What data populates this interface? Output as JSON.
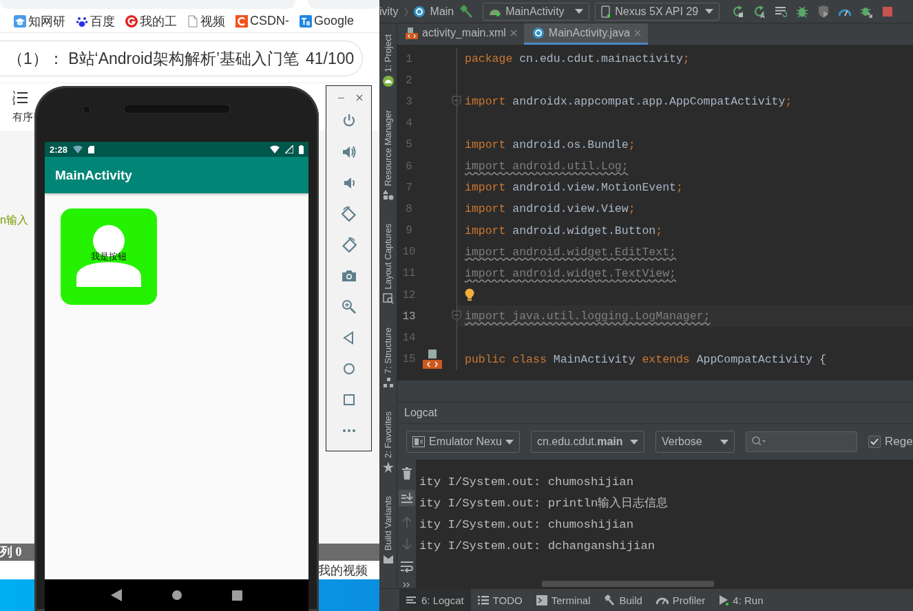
{
  "browser": {
    "bookmarks": [
      {
        "label": "知网研",
        "kind": "cap"
      },
      {
        "label": "百度",
        "kind": "paw"
      },
      {
        "label": "我的工",
        "kind": "ring"
      },
      {
        "label": "视频",
        "kind": "page"
      },
      {
        "label": "CSDN-",
        "kind": "square"
      },
      {
        "label": "Google",
        "kind": "translate"
      }
    ],
    "title_field": {
      "value": "（1）： B站‘Android架构解析’基础入门笔",
      "counter": "41/100"
    },
    "toolbar": [
      {
        "label": "有序"
      }
    ],
    "log_fragment": "n输入",
    "status_bar": "列 0",
    "footer_link": "我的视频"
  },
  "emulator": {
    "time": "2:28",
    "app_title": "MainActivity",
    "button_label": "我是按钮"
  },
  "ide": {
    "breadcrumbs": [
      "ivity",
      "Main"
    ],
    "run_config": "MainActivity",
    "device": "Nexus 5X API 29",
    "tool_windows": [
      {
        "label": "1: Project",
        "kind": "project"
      },
      {
        "label": "Resource Manager",
        "kind": "resource"
      },
      {
        "label": "Layout Captures",
        "kind": "layout"
      },
      {
        "label": "7: Structure",
        "kind": "structure"
      },
      {
        "label": "2: Favorites",
        "kind": "favorites"
      },
      {
        "label": "Build Variants",
        "kind": "variants"
      }
    ],
    "editor_tabs": [
      {
        "label": "activity_main.xml",
        "kind": "xml",
        "selected": false
      },
      {
        "label": "MainActivity.java",
        "kind": "java",
        "selected": true
      }
    ],
    "code_lines": [
      {
        "number": "1",
        "tokens": [
          {
            "text": "package",
            "kind": "keyword"
          },
          {
            "text": " cn.edu.cdut.mainactivity",
            "kind": "plain"
          },
          {
            "text": ";",
            "kind": "keyword"
          }
        ],
        "unused": false,
        "current": false
      },
      {
        "number": "2",
        "current": false
      },
      {
        "number": "3",
        "tokens": [
          {
            "text": "import",
            "kind": "keyword"
          },
          {
            "text": " androidx.appcompat.app.AppCompatActivity",
            "kind": "plain"
          },
          {
            "text": ";",
            "kind": "keyword"
          }
        ],
        "unused": false,
        "current": false,
        "kind": "fold"
      },
      {
        "number": "4",
        "current": false
      },
      {
        "number": "5",
        "tokens": [
          {
            "text": "import",
            "kind": "keyword"
          },
          {
            "text": " android.os.Bundle",
            "kind": "plain"
          },
          {
            "text": ";",
            "kind": "keyword"
          }
        ],
        "unused": false,
        "current": false
      },
      {
        "number": "6",
        "tokens": [
          {
            "text": "import android.util.Log;",
            "kind": "plain"
          }
        ],
        "unused": true,
        "current": false
      },
      {
        "number": "7",
        "tokens": [
          {
            "text": "import",
            "kind": "keyword"
          },
          {
            "text": " android.view.MotionEvent",
            "kind": "plain"
          },
          {
            "text": ";",
            "kind": "keyword"
          }
        ],
        "unused": false,
        "current": false
      },
      {
        "number": "8",
        "tokens": [
          {
            "text": "import",
            "kind": "keyword"
          },
          {
            "text": " android.view.View",
            "kind": "plain"
          },
          {
            "text": ";",
            "kind": "keyword"
          }
        ],
        "unused": false,
        "current": false
      },
      {
        "number": "9",
        "tokens": [
          {
            "text": "import",
            "kind": "keyword"
          },
          {
            "text": " android.widget.Button",
            "kind": "plain"
          },
          {
            "text": ";",
            "kind": "keyword"
          }
        ],
        "unused": false,
        "current": false
      },
      {
        "number": "10",
        "tokens": [
          {
            "text": "import android.widget.EditText;",
            "kind": "plain"
          }
        ],
        "unused": true,
        "current": false
      },
      {
        "number": "11",
        "tokens": [
          {
            "text": "import android.widget.TextView;",
            "kind": "plain"
          }
        ],
        "unused": true,
        "current": false
      },
      {
        "number": "12",
        "current": false,
        "kind": "bulb"
      },
      {
        "number": "13",
        "tokens": [
          {
            "text": "import java.util.logging.LogManager;",
            "kind": "plain"
          }
        ],
        "unused": true,
        "current": true,
        "kind": "fold"
      },
      {
        "number": "14",
        "current": false
      },
      {
        "number": "15",
        "tokens": [
          {
            "text": "public class",
            "kind": "keyword"
          },
          {
            "text": " MainActivity ",
            "kind": "plain"
          },
          {
            "text": "extends",
            "kind": "keyword"
          },
          {
            "text": " AppCompatActivity {",
            "kind": "plain"
          }
        ],
        "unused": false,
        "current": false,
        "kind": "layout"
      }
    ],
    "logcat": {
      "title": "Logcat",
      "device": "Emulator Nexu",
      "package": "cn.edu.cdut.**main**",
      "level": "Verbose",
      "regex": {
        "label": "Rege",
        "checked": true
      },
      "lines": [
        "ity I/System.out: chumoshijian",
        "ity I/System.out: println输入日志信息",
        "ity I/System.out: chumoshijian",
        "ity I/System.out: dchanganshijian"
      ]
    },
    "bottom_tabs": [
      {
        "label": "6: Logcat",
        "kind": "logcat",
        "selected": true
      },
      {
        "label": "TODO",
        "kind": "todo",
        "selected": false
      },
      {
        "label": "Terminal",
        "kind": "terminal",
        "selected": false
      },
      {
        "label": "Build",
        "kind": "build",
        "selected": false
      },
      {
        "label": "Profiler",
        "kind": "profiler",
        "selected": false
      },
      {
        "label": "4: Run",
        "kind": "run",
        "selected": false
      }
    ]
  }
}
